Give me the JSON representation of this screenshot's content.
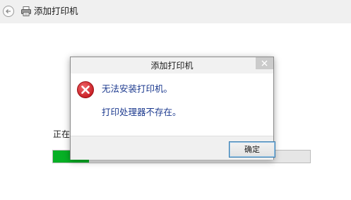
{
  "window": {
    "title": "添加打印机"
  },
  "main": {
    "status_text": "正在安",
    "progress_fraction": 0.14,
    "colors": {
      "progress": "#06b025",
      "track": "#e6e6e6"
    }
  },
  "dialog": {
    "title": "添加打印机",
    "icon": "error-icon",
    "message_line1": "无法安装打印机。",
    "message_line2": "打印处理器不存在。",
    "ok_label": "确定",
    "colors": {
      "message": "#1c3a8f",
      "error": "#d42027"
    }
  }
}
